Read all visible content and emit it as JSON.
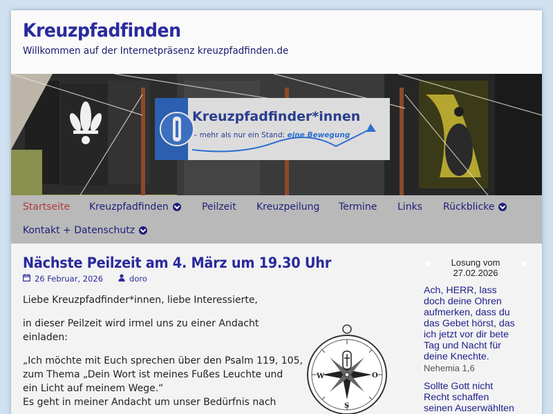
{
  "header": {
    "site_title": "Kreuzpfadfinden",
    "site_description": "Willkommen auf der Internetpräsenz kreuzpfadfinden.de"
  },
  "banner": {
    "sign_title": "Kreuzpfadfinder*innen",
    "sign_tagline_1": "– mehr als nur ein Stand: ",
    "sign_tagline_2": "eine Bewegung"
  },
  "nav": {
    "items": [
      {
        "label": "Startseite",
        "active": true,
        "dropdown": false
      },
      {
        "label": "Kreuzpfadfinden",
        "active": false,
        "dropdown": true
      },
      {
        "label": "Peilzeit",
        "active": false,
        "dropdown": false
      },
      {
        "label": "Kreuzpeilung",
        "active": false,
        "dropdown": false
      },
      {
        "label": "Termine",
        "active": false,
        "dropdown": false
      },
      {
        "label": "Links",
        "active": false,
        "dropdown": false
      },
      {
        "label": "Rückblicke",
        "active": false,
        "dropdown": true
      },
      {
        "label": "Kontakt + Datenschutz",
        "active": false,
        "dropdown": true
      }
    ]
  },
  "post": {
    "title": "Nächste Peilzeit am 4. März um 19.30 Uhr",
    "date": "26 Februar, 2026",
    "author": "doro",
    "p1": "Liebe Kreuzpfadfinder*innen, liebe Interessierte,",
    "p2_l1": "in dieser Peilzeit wird irmel uns zu einer Andacht",
    "p2_l2": "einladen:",
    "p3_l1": "„Ich möchte mit Euch sprechen über den Psalm 119, 105,",
    "p3_l2": "zum Thema „Dein Wort ist meines Fußes Leuchte und",
    "p3_l3": "ein Licht auf meinem Wege.“",
    "p3_l4": "Es geht in meiner Andacht um unser Bedürfnis nach"
  },
  "compass": {
    "w": "W",
    "o": "O",
    "s": "S"
  },
  "sidebar": {
    "losung_label": "Losung vom",
    "losung_date": "27.02.2026",
    "verse1": [
      "Ach, HERR, lass",
      "doch deine Ohren",
      "aufmerken, dass du",
      "das Gebet hörst, das",
      "ich jetzt vor dir bete",
      "Tag und Nacht für",
      "deine Knechte."
    ],
    "ref1": "Nehemia 1,6",
    "verse2": [
      "Sollte Gott nicht",
      "Recht schaffen",
      "seinen Auserwählten"
    ]
  },
  "colors": {
    "title": "#2a2a9e",
    "nav_bg": "#b9b9b9",
    "nav_active": "#b03a3a",
    "page_bg": "#cfe0f0"
  }
}
